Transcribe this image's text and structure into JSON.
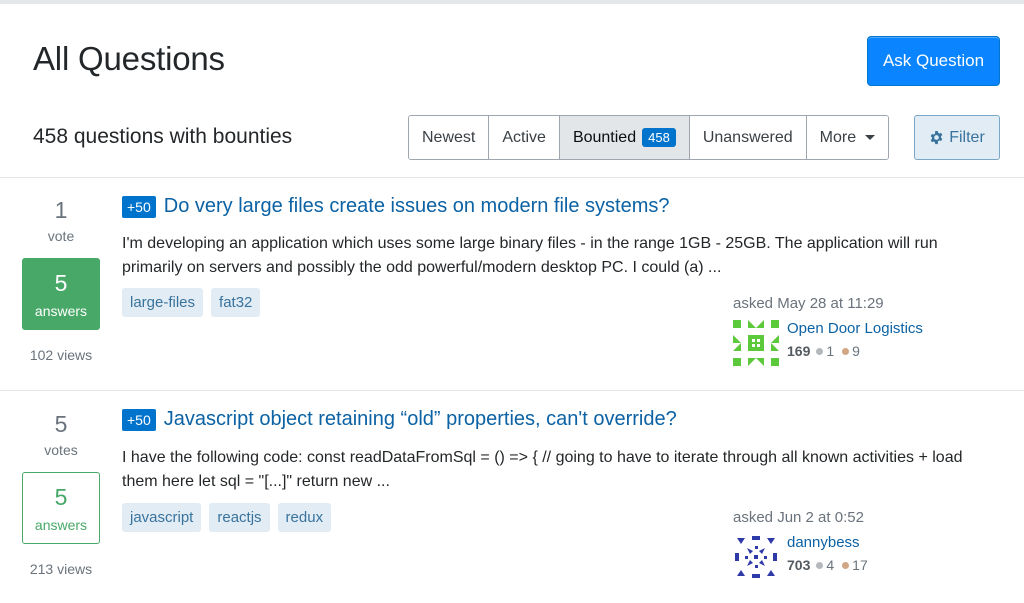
{
  "header": {
    "title": "All Questions",
    "ask_button": "Ask Question"
  },
  "subheader": {
    "count_text": "458 questions with bounties",
    "tabs": [
      {
        "label": "Newest"
      },
      {
        "label": "Active"
      },
      {
        "label": "Bountied",
        "badge": "458",
        "active": true
      },
      {
        "label": "Unanswered"
      },
      {
        "label": "More"
      }
    ],
    "filter_button": "Filter"
  },
  "questions": [
    {
      "votes": "1",
      "votes_label": "vote",
      "answers": "5",
      "answers_label": "answers",
      "answers_accepted": true,
      "views": "102 views",
      "bounty": "+50",
      "title": "Do very large files create issues on modern file systems?",
      "excerpt": "I'm developing an application which uses some large binary files - in the range 1GB - 25GB. The application will run primarily on servers and possibly the odd powerful/modern desktop PC. I could (a) ...",
      "tags": [
        "large-files",
        "fat32"
      ],
      "asked": "asked May 28 at 11:29",
      "user": {
        "name": "Open Door Logistics",
        "rep": "169",
        "silver": "1",
        "bronze": "9"
      }
    },
    {
      "votes": "5",
      "votes_label": "votes",
      "answers": "5",
      "answers_label": "answers",
      "answers_accepted": false,
      "views": "213 views",
      "bounty": "+50",
      "title": "Javascript object retaining “old” properties, can't override?",
      "excerpt": "I have the following code: const readDataFromSql = () => { // going to have to iterate through all known activities + load them here let sql = \"[...]\" return new ...",
      "tags": [
        "javascript",
        "reactjs",
        "redux"
      ],
      "asked": "asked Jun 2 at 0:52",
      "user": {
        "name": "dannybess",
        "rep": "703",
        "silver": "4",
        "bronze": "17"
      }
    }
  ],
  "colors": {
    "accent_blue": "#0a84ff",
    "link_blue": "#0b62a4",
    "accepted_green": "#48a868",
    "bounty_blue": "#0074cc"
  },
  "icons": {
    "filter": "gear-icon",
    "more": "caret-down-icon"
  }
}
